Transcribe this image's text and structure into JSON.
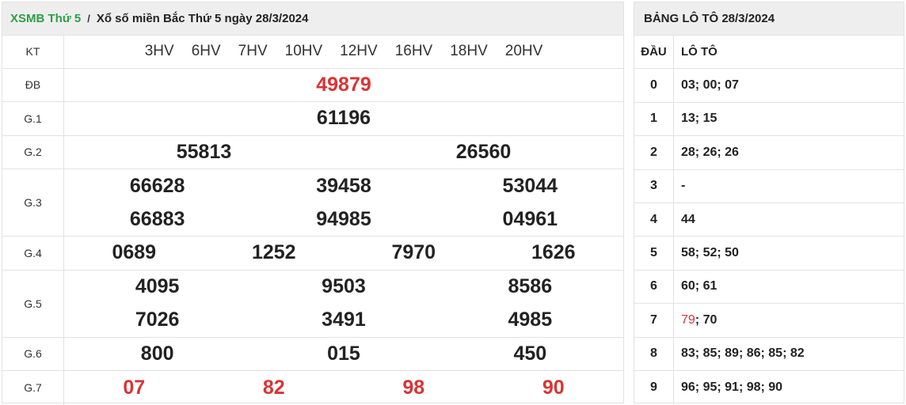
{
  "header": {
    "link": "XSMB Thứ 5",
    "separator": "/",
    "title": "Xổ số miền Bắc Thứ 5 ngày 28/3/2024"
  },
  "kt": {
    "label": "KT",
    "codes": [
      "3HV",
      "6HV",
      "7HV",
      "10HV",
      "12HV",
      "16HV",
      "18HV",
      "20HV"
    ]
  },
  "prizes": {
    "db": {
      "label": "ĐB",
      "values": [
        "49879"
      ]
    },
    "g1": {
      "label": "G.1",
      "values": [
        "61196"
      ]
    },
    "g2": {
      "label": "G.2",
      "values": [
        "55813",
        "26560"
      ]
    },
    "g3": {
      "label": "G.3",
      "values": [
        "66628",
        "39458",
        "53044",
        "66883",
        "94985",
        "04961"
      ]
    },
    "g4": {
      "label": "G.4",
      "values": [
        "0689",
        "1252",
        "7970",
        "1626"
      ]
    },
    "g5": {
      "label": "G.5",
      "values": [
        "4095",
        "9503",
        "8586",
        "7026",
        "3491",
        "4985"
      ]
    },
    "g6": {
      "label": "G.6",
      "values": [
        "800",
        "015",
        "450"
      ]
    },
    "g7": {
      "label": "G.7",
      "values": [
        "07",
        "82",
        "98",
        "90"
      ]
    }
  },
  "loto": {
    "title": "BẢNG LÔ TÔ 28/3/2024",
    "col_dau": "ĐẦU",
    "col_loto": "LÔ TÔ",
    "rows": [
      {
        "dau": "0",
        "lt": "03; 00; 07"
      },
      {
        "dau": "1",
        "lt": "13; 15"
      },
      {
        "dau": "2",
        "lt": "28; 26; 26"
      },
      {
        "dau": "3",
        "lt": "-"
      },
      {
        "dau": "4",
        "lt": "44"
      },
      {
        "dau": "5",
        "lt": "58; 52; 50"
      },
      {
        "dau": "6",
        "lt": "60; 61"
      },
      {
        "dau": "7",
        "lt_hl": "79",
        "lt": "; 70"
      },
      {
        "dau": "8",
        "lt": "83; 85; 89; 86; 85; 82"
      },
      {
        "dau": "9",
        "lt": "96; 95; 91; 98; 90"
      }
    ]
  },
  "colors": {
    "accent_green": "#2e9e45",
    "highlight_red": "#d93434"
  }
}
